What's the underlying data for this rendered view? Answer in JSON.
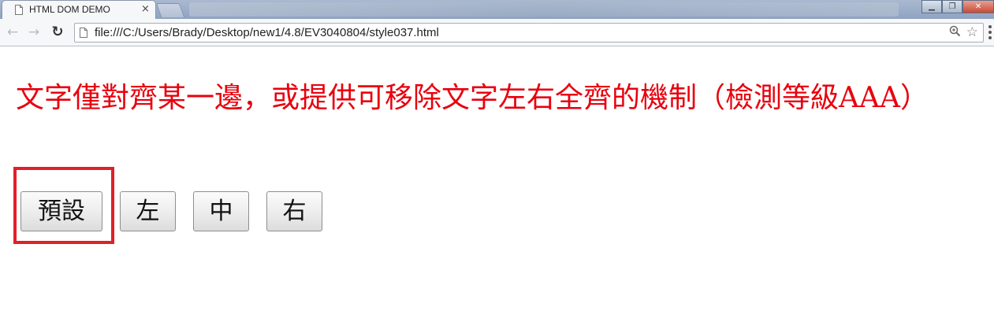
{
  "browser": {
    "tab": {
      "title": "HTML DOM DEMO",
      "close_glyph": "×"
    },
    "url": "file:///C:/Users/Brady/Desktop/new1/4.8/EV3040804/style037.html",
    "window_controls": {
      "minimize": "▁",
      "restore": "❐",
      "close": "✕"
    },
    "nav": {
      "back_glyph": "←",
      "forward_glyph": "→",
      "reload_glyph": "↻"
    },
    "icons": {
      "zoom": "🔍",
      "star": "☆"
    }
  },
  "page": {
    "heading": "文字僅對齊某一邊，或提供可移除文字左右全齊的機制（檢測等級AAA）",
    "buttons": {
      "default": "預設",
      "left": "左",
      "center": "中",
      "right": "右"
    }
  },
  "colors": {
    "heading": "#e8000d",
    "highlight_border": "#e0202a"
  }
}
